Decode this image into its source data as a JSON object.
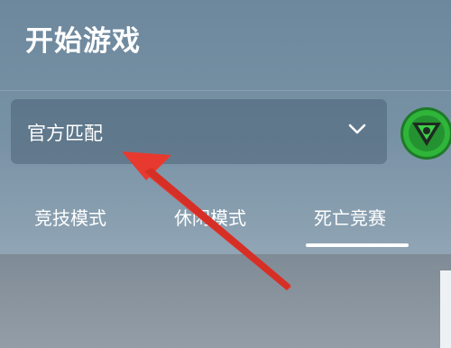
{
  "header": {
    "title": "开始游戏"
  },
  "match_select": {
    "selected": "官方匹配",
    "chevron_icon": "chevron-down-icon"
  },
  "emblem": {
    "icon": "rank-emblem-icon",
    "color": "#2fb53a"
  },
  "tabs": [
    {
      "label": "竞技模式",
      "active": false
    },
    {
      "label": "休闲模式",
      "active": false
    },
    {
      "label": "死亡竞赛",
      "active": true
    }
  ],
  "annotation": {
    "icon": "red-arrow-icon",
    "color": "#e8392f"
  }
}
